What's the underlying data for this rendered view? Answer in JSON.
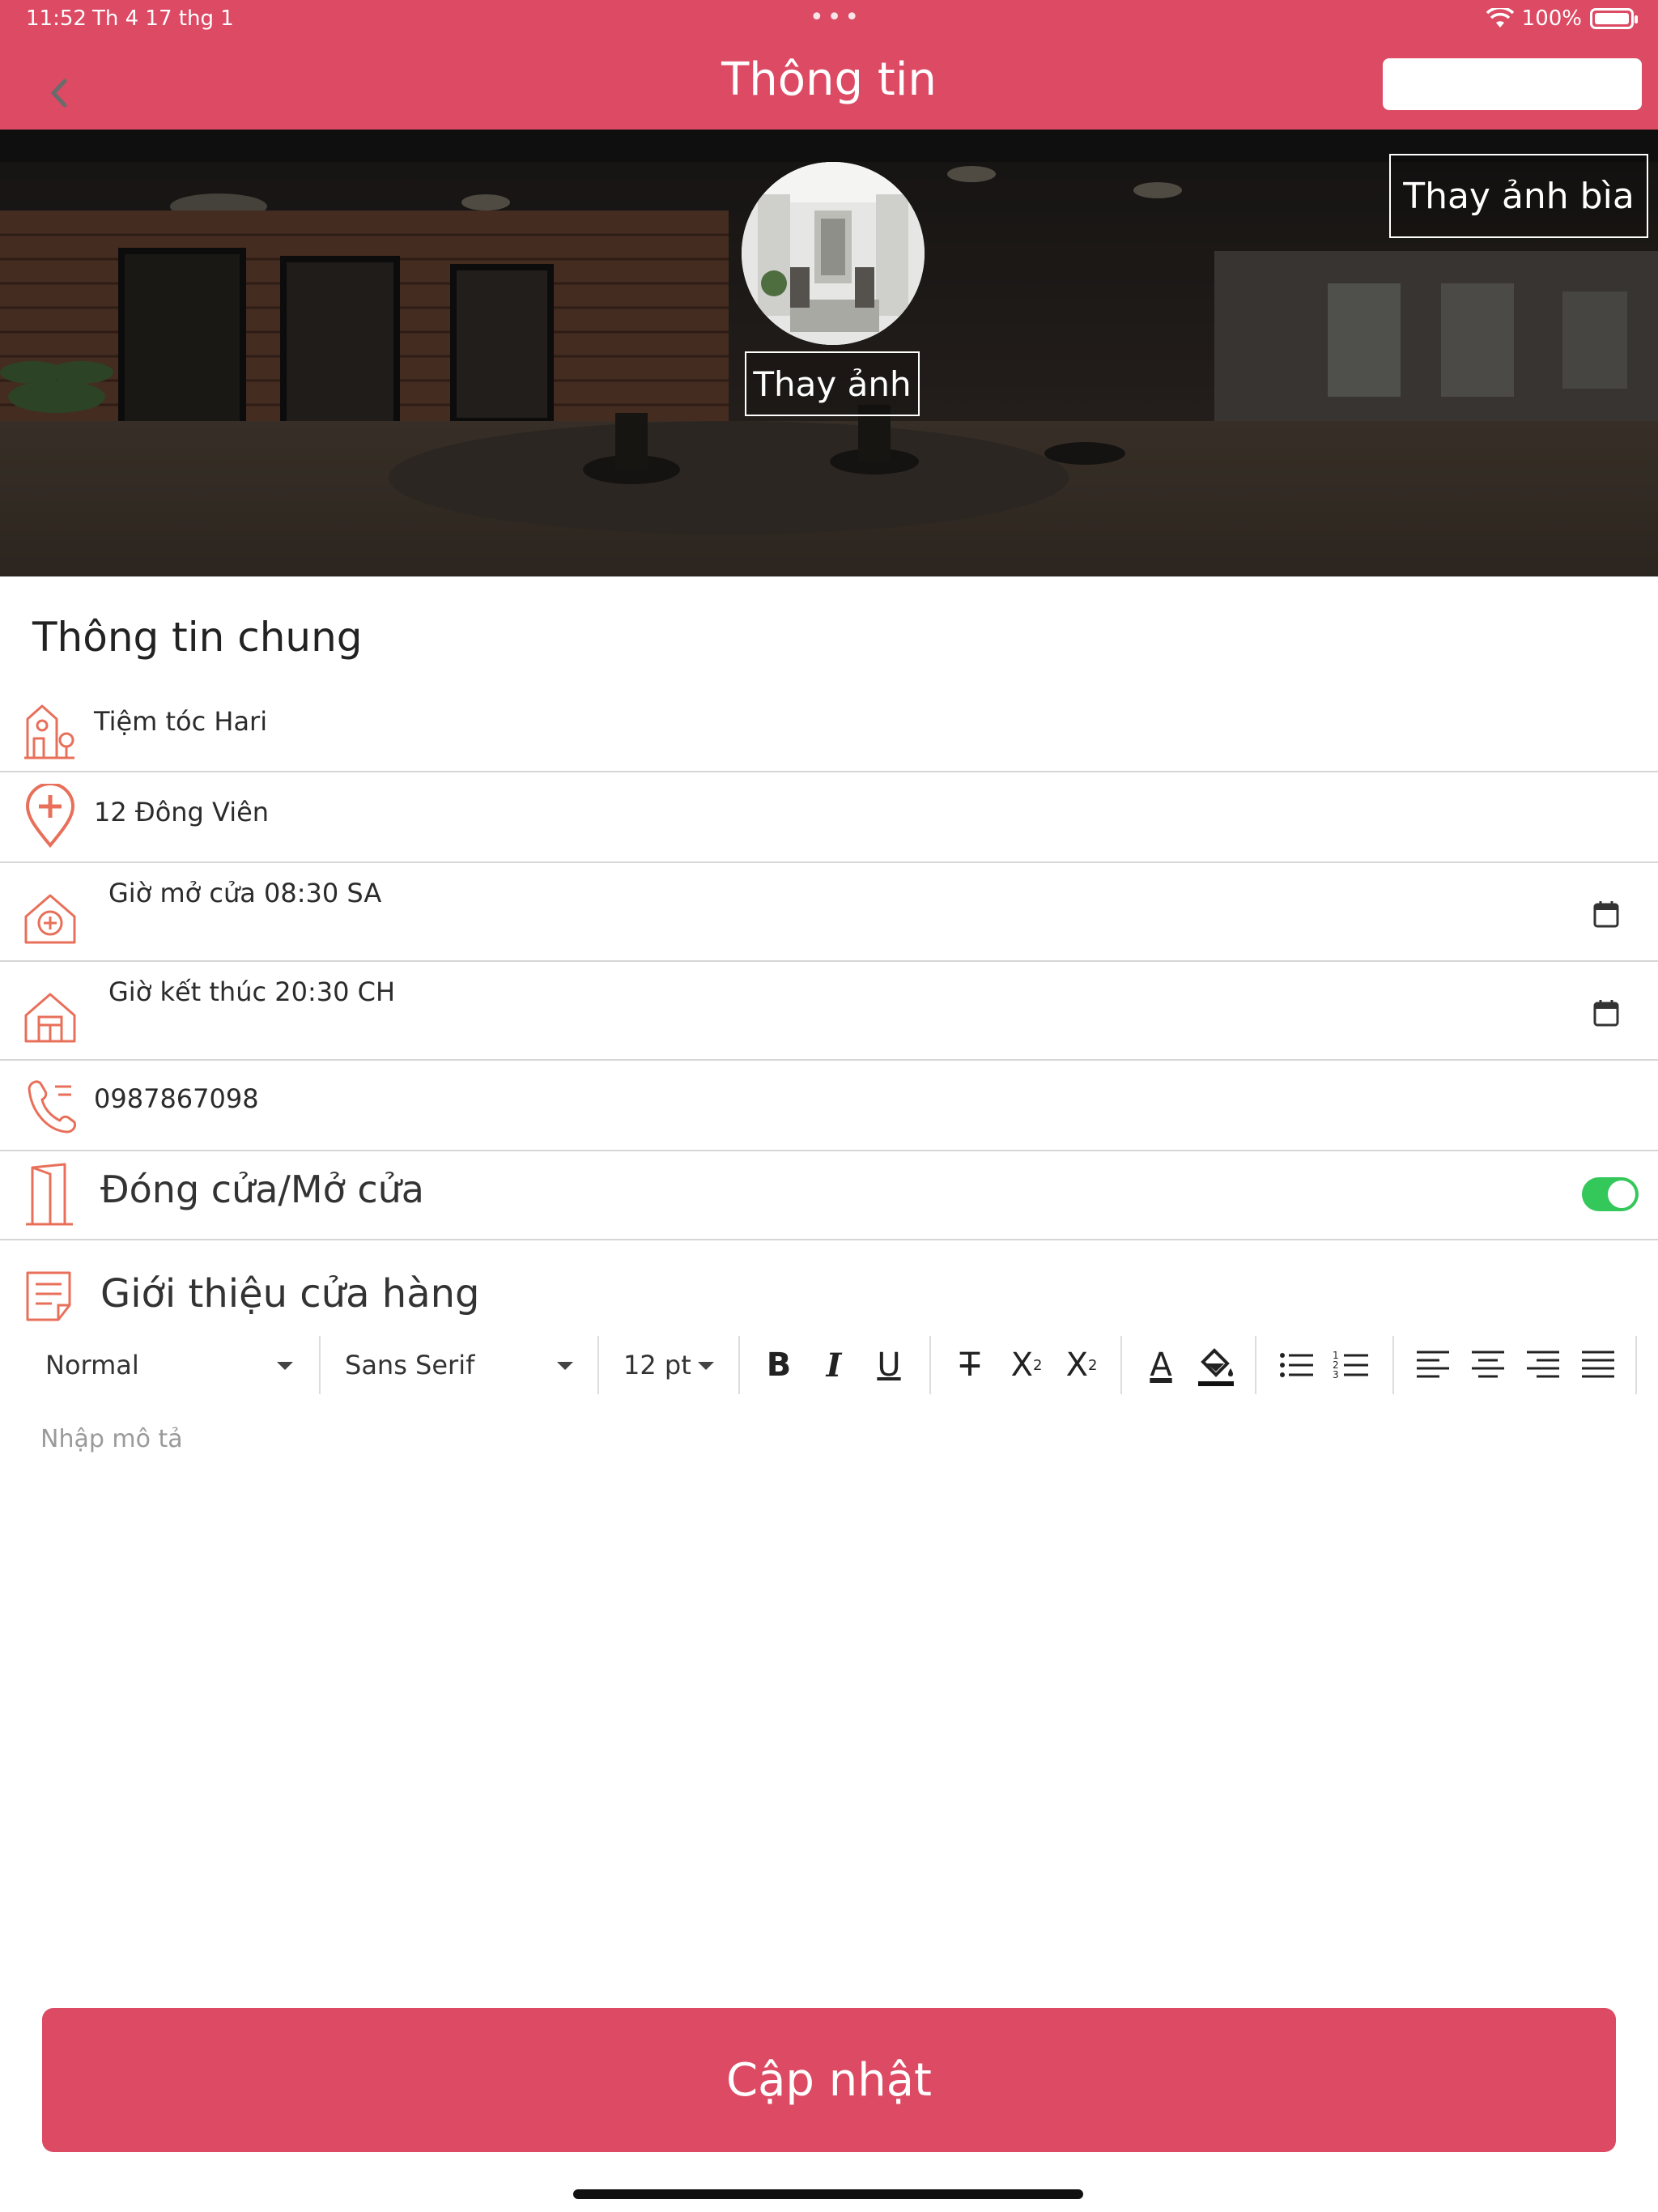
{
  "status_bar": {
    "time": "11:52",
    "date": "Th 4 17 thg 1",
    "battery": "100%"
  },
  "header": {
    "title": "Thông tin"
  },
  "cover": {
    "change_cover_label": "Thay ảnh bìa",
    "change_avatar_label": "Thay ảnh"
  },
  "section": {
    "title": "Thông tin chung"
  },
  "fields": {
    "shop_name": "Tiệm tóc Hari",
    "address": "12 Đông Viên",
    "open_time": "Giờ mở cửa 08:30 SA",
    "close_time": "Giờ kết thúc 20:30 CH",
    "phone": "0987867098"
  },
  "toggle": {
    "label": "Đóng cửa/Mở cửa",
    "on": true
  },
  "editor": {
    "title": "Giới thiệu cửa hàng",
    "format": "Normal",
    "font": "Sans Serif",
    "size": "12 pt",
    "placeholder": "Nhập mô tả"
  },
  "update_button": "Cập nhật",
  "colors": {
    "accent": "#dc4a64",
    "icon": "#e8705a",
    "toggle_on": "#34c759"
  }
}
